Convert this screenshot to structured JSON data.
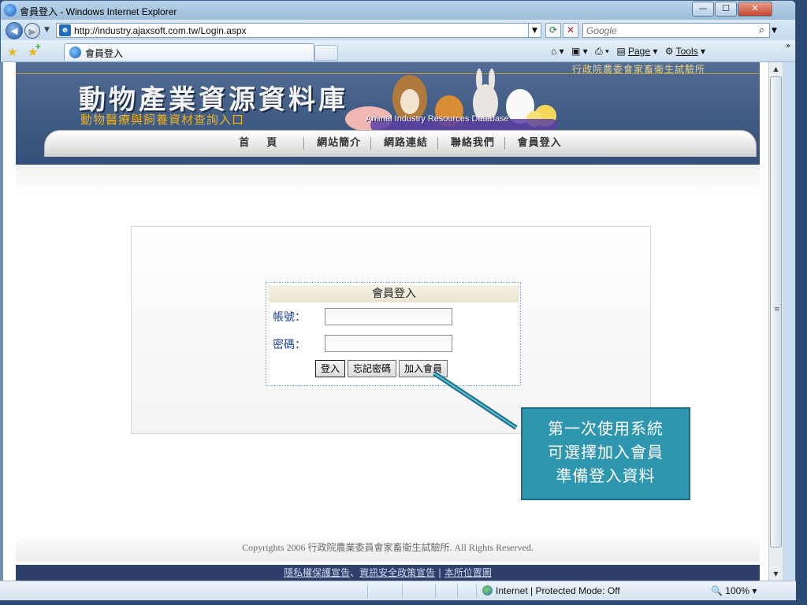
{
  "window": {
    "title": "會員登入 - Windows Internet Explorer",
    "min": "—",
    "max": "☐",
    "close": "✕"
  },
  "address": {
    "url": "http://industry.ajaxsoft.com.tw/Login.aspx",
    "search_placeholder": "Google"
  },
  "tabs": [
    {
      "label": "會員登入"
    }
  ],
  "command_bar": {
    "page": "Page",
    "tools": "Tools"
  },
  "site": {
    "agency": "行政院農委會家畜衛生試驗所",
    "title": "動物產業資源資料庫",
    "subtitle": "動物醫療與飼養資材查詢入口",
    "banner_caption": "Animal Industry Resources Database",
    "nav": [
      "首頁",
      "網站簡介",
      "網路連結",
      "聯絡我們",
      "會員登入"
    ]
  },
  "login": {
    "header": "會員登入",
    "account_label": "帳號：",
    "password_label": "密碼：",
    "account_value": "",
    "password_value": "",
    "login_button": "登入",
    "forgot_button": "忘記密碼",
    "join_button": "加入會員"
  },
  "footer": {
    "copyright": "Copyrights 2006 行政院農業委員會家畜衛生試驗所. All Rights Reserved.",
    "privacy": "隱私權保護宣告",
    "sep1": "、",
    "security": "資訊安全政策宣告",
    "sep2": " | ",
    "location": "本所位置圖"
  },
  "callout": {
    "line1": "第一次使用系統",
    "line2": "可選擇加入會員",
    "line3": "準備登入資料"
  },
  "status": {
    "zone": "Internet | Protected Mode: Off",
    "zoom": "100%"
  }
}
